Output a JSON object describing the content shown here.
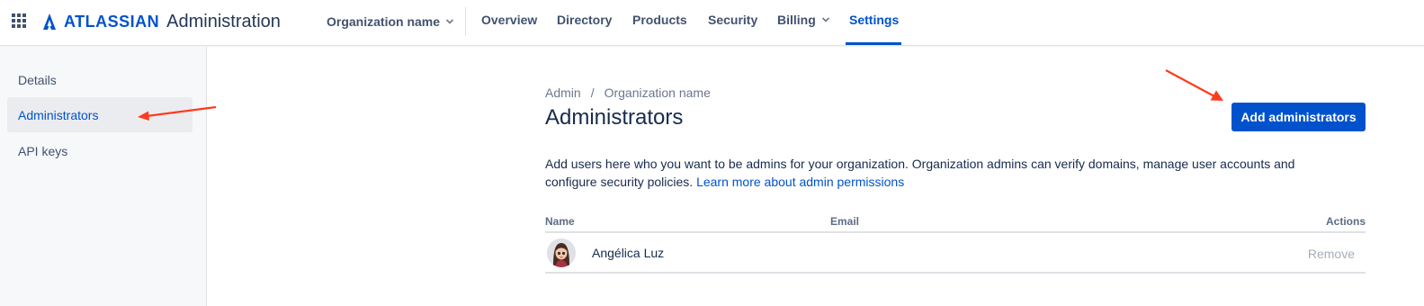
{
  "header": {
    "logo_word": "ATLASSIAN",
    "product": "Administration",
    "org_selector": "Organization name",
    "nav": [
      {
        "label": "Overview"
      },
      {
        "label": "Directory"
      },
      {
        "label": "Products"
      },
      {
        "label": "Security"
      },
      {
        "label": "Billing"
      },
      {
        "label": "Settings",
        "active": true
      }
    ]
  },
  "sidebar": {
    "items": [
      {
        "label": "Details"
      },
      {
        "label": "Administrators",
        "active": true
      },
      {
        "label": "API keys"
      }
    ]
  },
  "main": {
    "breadcrumb": [
      "Admin",
      "Organization name"
    ],
    "title": "Administrators",
    "add_button": "Add administrators",
    "description": "Add users here who you want to be admins for your organization. Organization admins can verify domains, manage user accounts and configure security policies. ",
    "learn_more": "Learn more about admin permissions",
    "table": {
      "columns": [
        "Name",
        "Email",
        "Actions"
      ],
      "rows": [
        {
          "name": "Angélica Luz",
          "email": "",
          "action": "Remove"
        }
      ]
    }
  },
  "colors": {
    "brand_blue": "#0052cc",
    "annotation_red": "#ff3b1f"
  },
  "icons": [
    "app-switcher-icon",
    "atlassian-logo-icon",
    "chevron-down-icon",
    "avatar-image",
    "annotation-arrow"
  ]
}
